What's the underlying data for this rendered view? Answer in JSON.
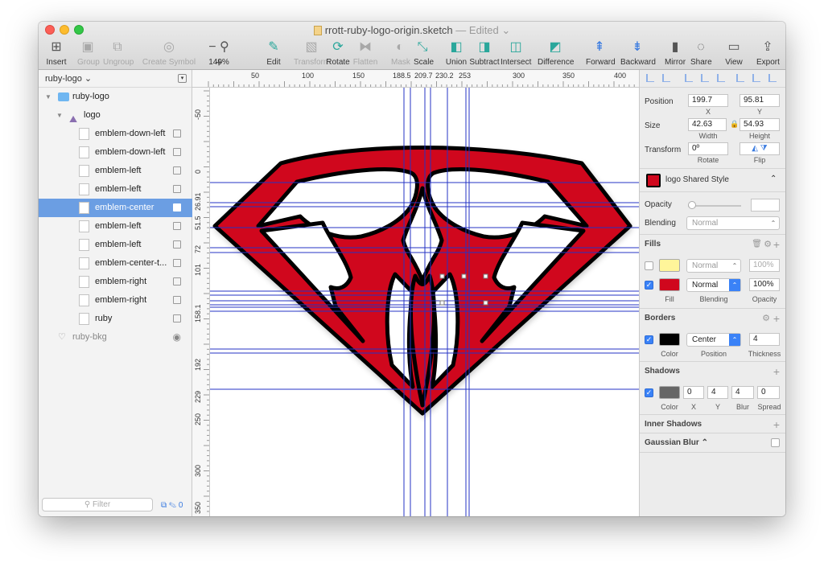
{
  "window": {
    "title": "rrott-ruby-logo-origin.sketch",
    "status": "— Edited ⌄"
  },
  "toolbar": [
    {
      "id": "insert",
      "label": "Insert",
      "icon": "plus-icon",
      "disabled": false
    },
    {
      "id": "group",
      "label": "Group",
      "icon": "group-icon",
      "disabled": true
    },
    {
      "id": "ungroup",
      "label": "Ungroup",
      "icon": "ungroup-icon",
      "disabled": true
    },
    {
      "id": "create-symbol",
      "label": "Create Symbol",
      "icon": "symbol-icon",
      "disabled": true
    },
    {
      "id": "zoom",
      "label": "149%",
      "icon": "zoom-icon",
      "disabled": false
    },
    {
      "id": "edit",
      "label": "Edit",
      "icon": "edit-icon",
      "disabled": false
    },
    {
      "id": "transform",
      "label": "Transform",
      "icon": "transform-icon",
      "disabled": true
    },
    {
      "id": "rotate",
      "label": "Rotate",
      "icon": "rotate-icon",
      "disabled": false
    },
    {
      "id": "flatten",
      "label": "Flatten",
      "icon": "flatten-icon",
      "disabled": true
    },
    {
      "id": "mask",
      "label": "Mask",
      "icon": "mask-icon",
      "disabled": true
    },
    {
      "id": "scale",
      "label": "Scale",
      "icon": "scale-icon",
      "disabled": false
    },
    {
      "id": "union",
      "label": "Union",
      "icon": "union-icon",
      "disabled": false
    },
    {
      "id": "subtract",
      "label": "Subtract",
      "icon": "subtract-icon",
      "disabled": false
    },
    {
      "id": "intersect",
      "label": "Intersect",
      "icon": "intersect-icon",
      "disabled": false
    },
    {
      "id": "difference",
      "label": "Difference",
      "icon": "difference-icon",
      "disabled": false
    },
    {
      "id": "forward",
      "label": "Forward",
      "icon": "forward-icon",
      "disabled": false
    },
    {
      "id": "backward",
      "label": "Backward",
      "icon": "backward-icon",
      "disabled": false
    },
    {
      "id": "mirror",
      "label": "Mirror",
      "icon": "mirror-icon",
      "disabled": false
    },
    {
      "id": "share",
      "label": "Share",
      "icon": "share-icon",
      "disabled": false
    },
    {
      "id": "view",
      "label": "View",
      "icon": "view-icon",
      "disabled": false
    },
    {
      "id": "export",
      "label": "Export",
      "icon": "export-icon",
      "disabled": false
    }
  ],
  "page_selector": "ruby-logo ⌄",
  "layers": [
    {
      "name": "ruby-logo",
      "level": 0,
      "kind": "folder",
      "selected": false
    },
    {
      "name": "logo",
      "level": 1,
      "kind": "group",
      "selected": false
    },
    {
      "name": "emblem-down-left",
      "level": 2,
      "kind": "shape",
      "selected": false
    },
    {
      "name": "emblem-down-left",
      "level": 2,
      "kind": "shape",
      "selected": false
    },
    {
      "name": "emblem-left",
      "level": 2,
      "kind": "shape",
      "selected": false
    },
    {
      "name": "emblem-left",
      "level": 2,
      "kind": "shape",
      "selected": false
    },
    {
      "name": "emblem-center",
      "level": 2,
      "kind": "shape",
      "selected": true
    },
    {
      "name": "emblem-left",
      "level": 2,
      "kind": "shape",
      "selected": false
    },
    {
      "name": "emblem-left",
      "level": 2,
      "kind": "shape",
      "selected": false
    },
    {
      "name": "emblem-center-t...",
      "level": 2,
      "kind": "shape",
      "selected": false
    },
    {
      "name": "emblem-right",
      "level": 2,
      "kind": "shape",
      "selected": false
    },
    {
      "name": "emblem-right",
      "level": 2,
      "kind": "shape",
      "selected": false
    },
    {
      "name": "ruby",
      "level": 2,
      "kind": "shape",
      "selected": false
    },
    {
      "name": "ruby-bkg",
      "level": 1,
      "kind": "hidden",
      "selected": false
    }
  ],
  "filter_placeholder": "Filter",
  "filter_count": "0",
  "ruler_top": [
    "50",
    "100",
    "150",
    "188.5",
    "209.7",
    "230.2",
    "253",
    "300",
    "350",
    "400"
  ],
  "ruler_left": [
    "-50",
    "0",
    "26.91",
    "51.5",
    "72",
    "101",
    "158.1",
    "192",
    "229",
    "250",
    "300",
    "350"
  ],
  "inspector": {
    "position_label": "Position",
    "x": "199.7",
    "y": "95.81",
    "x_label": "X",
    "y_label": "Y",
    "size_label": "Size",
    "width": "42.63",
    "height": "54.93",
    "width_label": "Width",
    "height_label": "Height",
    "transform_label": "Transform",
    "rotate": "0º",
    "rotate_label": "Rotate",
    "flip_label": "Flip",
    "shared_style": "logo Shared Style",
    "opacity_label": "Opacity",
    "blending_label": "Blending",
    "blending_value": "Normal",
    "fills_title": "Fills",
    "fill1_blend": "Normal",
    "fill1_opacity": "100%",
    "fill2_blend": "Normal",
    "fill2_opacity": "100%",
    "fill_label": "Fill",
    "fill_blending_label": "Blending",
    "fill_opacity_label": "Opacity",
    "borders_title": "Borders",
    "border_position": "Center",
    "border_thickness": "4",
    "border_color_label": "Color",
    "border_position_label": "Position",
    "border_thickness_label": "Thickness",
    "shadows_title": "Shadows",
    "shadow_x": "0",
    "shadow_y": "4",
    "shadow_blur": "4",
    "shadow_spread": "0",
    "shadow_color_label": "Color",
    "shadow_x_label": "X",
    "shadow_y_label": "Y",
    "shadow_blur_label": "Blur",
    "shadow_spread_label": "Spread",
    "inner_shadows_title": "Inner Shadows",
    "gaussian_title": "Gaussian Blur ⌃"
  },
  "colors": {
    "ruby_red": "#d0071d",
    "stroke": "#000000",
    "guide": "#2433c4",
    "fill_yellow": "#fff59a",
    "selection": "#6b9ee3"
  }
}
